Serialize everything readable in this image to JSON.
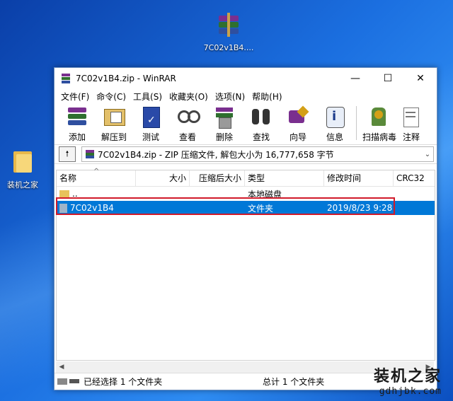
{
  "desktop": {
    "zip_icon_label": "7C02v1B4....",
    "folder_icon_label": "装机之家"
  },
  "window": {
    "title": "7C02v1B4.zip - WinRAR",
    "minimize": "—",
    "maximize": "☐",
    "close": "✕"
  },
  "menu": [
    "文件(F)",
    "命令(C)",
    "工具(S)",
    "收藏夹(O)",
    "选项(N)",
    "帮助(H)"
  ],
  "toolbar": [
    {
      "label": "添加",
      "icon": "add-icon"
    },
    {
      "label": "解压到",
      "icon": "extract-icon"
    },
    {
      "label": "测试",
      "icon": "test-icon"
    },
    {
      "label": "查看",
      "icon": "view-icon"
    },
    {
      "label": "删除",
      "icon": "delete-icon"
    },
    {
      "label": "查找",
      "icon": "find-icon"
    },
    {
      "label": "向导",
      "icon": "wizard-icon"
    },
    {
      "label": "信息",
      "icon": "info-icon"
    },
    {
      "label": "扫描病毒",
      "icon": "scan-virus-icon"
    },
    {
      "label": "注释",
      "icon": "comment-icon"
    }
  ],
  "pathbar": {
    "text": "7C02v1B4.zip - ZIP 压缩文件, 解包大小为 16,777,658 字节"
  },
  "columns": [
    "名称",
    "大小",
    "压缩后大小",
    "类型",
    "修改时间",
    "CRC32"
  ],
  "rows": [
    {
      "name": "..",
      "size": "",
      "packed": "",
      "type": "本地磁盘",
      "modified": "",
      "crc": ""
    },
    {
      "name": "7C02v1B4",
      "size": "",
      "packed": "",
      "type": "文件夹",
      "modified": "2019/8/23 9:28",
      "crc": ""
    }
  ],
  "status": {
    "left": "已经选择 1 个文件夹",
    "right": "总计 1 个文件夹"
  },
  "watermark": {
    "cn": "装机之家",
    "url": "gdhjbk.com"
  },
  "colors": {
    "selection": "#0078d7",
    "highlight_box": "#d11a2a"
  }
}
